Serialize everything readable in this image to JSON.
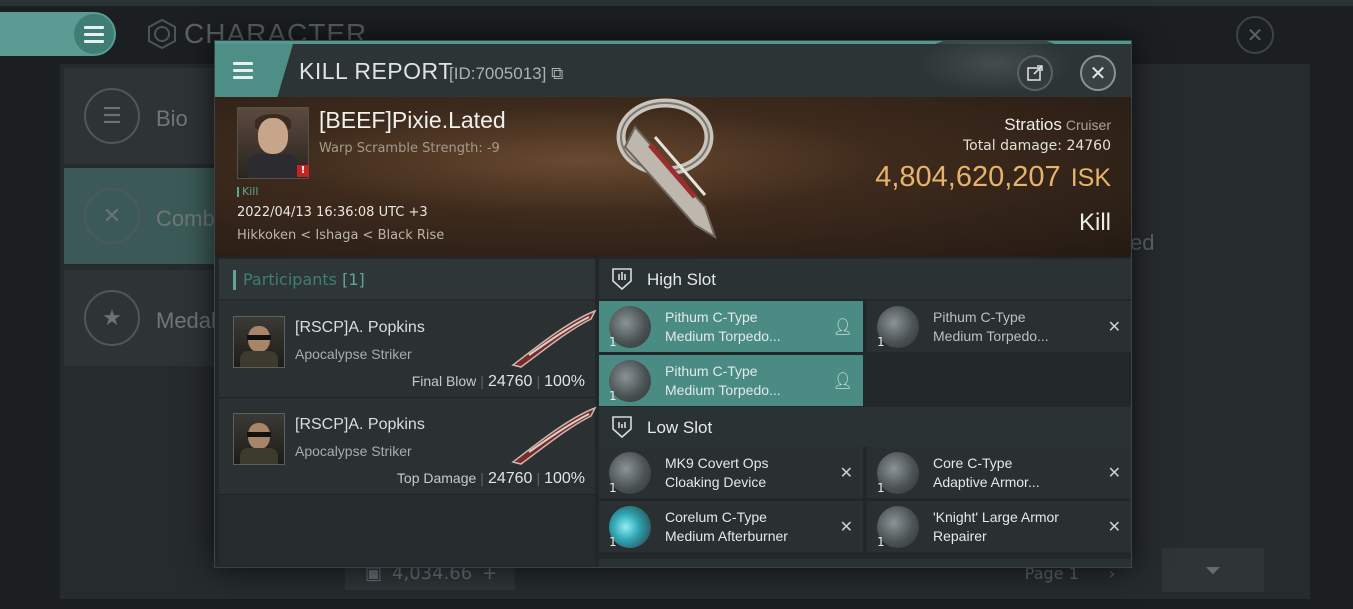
{
  "background": {
    "page_title": "CHARACTER",
    "side_nav": [
      {
        "label": "Bio",
        "icon": "list-icon"
      },
      {
        "label": "Comb",
        "icon": "crossed-swords-icon",
        "active": true
      },
      {
        "label": "Medal",
        "icon": "star-icon"
      }
    ],
    "right_peek_text": "ed",
    "footer_value": "4,034.66",
    "page_label": "Page 1"
  },
  "modal": {
    "title": "KILL REPORT",
    "id_text": "[ID:7005013]",
    "victim": {
      "name": "[BEEF]Pixie.Lated",
      "warp_scramble": "Warp Scramble Strength: -9",
      "tag": "Kill",
      "date": "2022/04/13 16:36:08 UTC +3",
      "location": "Hikkoken < Ishaga < Black Rise"
    },
    "ship": {
      "name": "Stratios",
      "class": "Cruiser",
      "total_damage_label": "Total damage:",
      "total_damage": "24760",
      "isk_value": "4,804,620,207",
      "isk_unit": "ISK",
      "result": "Kill"
    },
    "participants": {
      "label": "Participants",
      "count": "[1]",
      "rows": [
        {
          "name": "[RSCP]A. Popkins",
          "ship": "Apocalypse Striker",
          "role": "Final Blow",
          "damage": "24760",
          "percent": "100%"
        },
        {
          "name": "[RSCP]A. Popkins",
          "ship": "Apocalypse Striker",
          "role": "Top Damage",
          "damage": "24760",
          "percent": "100%"
        }
      ]
    },
    "slots": {
      "high": {
        "title": "High Slot",
        "items": [
          {
            "qty": "1",
            "line1": "Pithum C-Type",
            "line2": "Medium Torpedo...",
            "status": "user-icon",
            "highlighted": true
          },
          {
            "qty": "1",
            "line1": "Pithum C-Type",
            "line2": "Medium Torpedo...",
            "status": "close-icon",
            "highlighted": false
          },
          {
            "qty": "1",
            "line1": "Pithum C-Type",
            "line2": "Medium Torpedo...",
            "status": "user-icon",
            "highlighted": true
          }
        ]
      },
      "low": {
        "title": "Low Slot",
        "items": [
          {
            "qty": "1",
            "line1": "MK9 Covert Ops",
            "line2": "Cloaking Device",
            "status": "close-icon"
          },
          {
            "qty": "1",
            "line1": "Core C-Type",
            "line2": "Adaptive Armor...",
            "status": "close-icon"
          },
          {
            "qty": "1",
            "line1": "Corelum C-Type",
            "line2": "Medium Afterburner",
            "status": "close-icon"
          },
          {
            "qty": "1",
            "line1": "'Knight' Large Armor",
            "line2": "Repairer",
            "status": "close-icon"
          }
        ]
      }
    }
  },
  "colors": {
    "accent_teal": "#4a8c84",
    "isk_gold": "#e7b36a",
    "warning_red": "#c02626"
  }
}
